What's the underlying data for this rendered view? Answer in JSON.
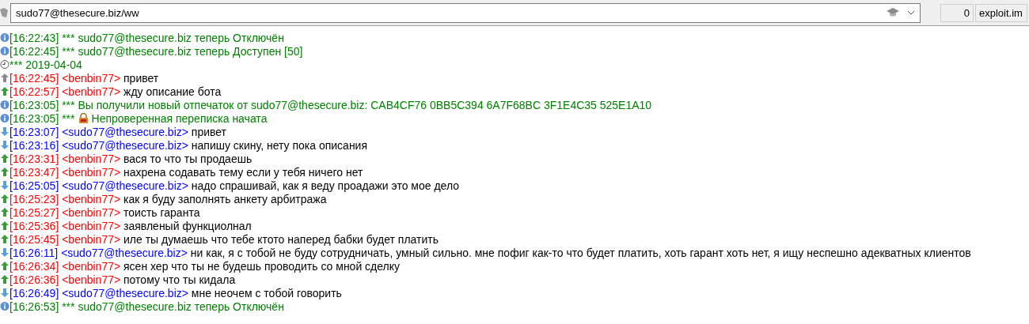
{
  "address": {
    "value": "sudo77@thesecure.biz/ww"
  },
  "counter": "0",
  "account": "exploit.im",
  "messages": [
    {
      "kind": "status",
      "time": "[16:22:43]",
      "prefix": "***",
      "text": "sudo77@thesecure.biz теперь Отключён",
      "lock": false
    },
    {
      "kind": "status",
      "time": "[16:22:45]",
      "prefix": "***",
      "text": "sudo77@thesecure.biz теперь Доступен [50]",
      "lock": false
    },
    {
      "kind": "date",
      "prefix": "***",
      "text": "2019-04-04"
    },
    {
      "kind": "outgoing",
      "delivered": false,
      "time": "[16:22:45]",
      "nick": "<benbin77>",
      "text": "привет"
    },
    {
      "kind": "outgoing",
      "delivered": true,
      "time": "[16:22:57]",
      "nick": "<benbin77>",
      "text": "жду описание бота"
    },
    {
      "kind": "status",
      "time": "[16:23:05]",
      "prefix": "***",
      "text": "Вы получили новый отпечаток от sudo77@thesecure.biz: CAB4CF76 0BB5C394 6A7F68BC 3F1E4C35 525E1A10",
      "lock": false
    },
    {
      "kind": "status",
      "time": "[16:23:05]",
      "prefix": "***",
      "text": "Непроверенная переписка начата",
      "lock": true
    },
    {
      "kind": "incoming",
      "time": "[16:23:07]",
      "nick": "<sudo77@thesecure.biz>",
      "text": "привет"
    },
    {
      "kind": "incoming",
      "time": "[16:23:16]",
      "nick": "<sudo77@thesecure.biz>",
      "text": "напишу скину, нету пока описания"
    },
    {
      "kind": "outgoing",
      "delivered": true,
      "time": "[16:23:31]",
      "nick": "<benbin77>",
      "text": "вася то что ты продаешь"
    },
    {
      "kind": "outgoing",
      "delivered": true,
      "time": "[16:23:47]",
      "nick": "<benbin77>",
      "text": "нахрена содавать тему если у тебя ничего нет"
    },
    {
      "kind": "incoming",
      "time": "[16:25:05]",
      "nick": "<sudo77@thesecure.biz>",
      "text": "надо спрашивай, как я веду проадажи это мое дело"
    },
    {
      "kind": "outgoing",
      "delivered": true,
      "time": "[16:25:23]",
      "nick": "<benbin77>",
      "text": "как я буду заполнять анкету арбитража"
    },
    {
      "kind": "outgoing",
      "delivered": true,
      "time": "[16:25:27]",
      "nick": "<benbin77>",
      "text": "тоисть гаранта"
    },
    {
      "kind": "outgoing",
      "delivered": true,
      "time": "[16:25:36]",
      "nick": "<benbin77>",
      "text": "заявленый функциолнал"
    },
    {
      "kind": "outgoing",
      "delivered": true,
      "time": "[16:25:45]",
      "nick": "<benbin77>",
      "text": "иле ты думаешь что тебе ктото наперед бабки будет платить"
    },
    {
      "kind": "incoming",
      "time": "[16:26:11]",
      "nick": "<sudo77@thesecure.biz>",
      "text": "ни как, я с тобой не буду сотрудничать, умный сильно. мне пофиг как-то что будет платить, хоть гарант хоть нет, я ищу неспешно адекватных клиентов"
    },
    {
      "kind": "outgoing",
      "delivered": true,
      "time": "[16:26:34]",
      "nick": "<benbin77>",
      "text": "ясен хер что ты не будешь проводить со мной сделку"
    },
    {
      "kind": "outgoing",
      "delivered": true,
      "time": "[16:26:36]",
      "nick": "<benbin77>",
      "text": "потому что ты кидала"
    },
    {
      "kind": "incoming",
      "time": "[16:26:49]",
      "nick": "<sudo77@thesecure.biz>",
      "text": "мне неочем с тобой говорить"
    },
    {
      "kind": "status",
      "time": "[16:26:53]",
      "prefix": "***",
      "text": "sudo77@thesecure.biz теперь Отключён",
      "lock": false
    }
  ]
}
